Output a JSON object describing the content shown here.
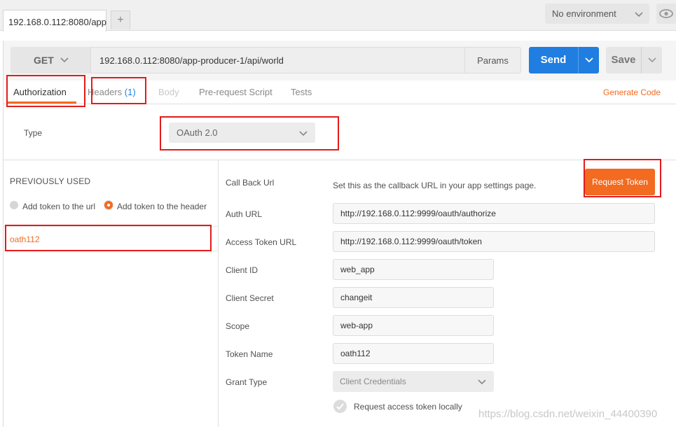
{
  "tab": {
    "title": "192.168.0.112:8080/app",
    "new_tab": "+"
  },
  "environment": {
    "selected": "No environment"
  },
  "request": {
    "method": "GET",
    "url": "192.168.0.112:8080/app-producer-1/api/world",
    "params_label": "Params",
    "send_label": "Send",
    "save_label": "Save"
  },
  "request_tabs": [
    {
      "label": "Authorization"
    },
    {
      "label": "Headers",
      "badge": "(1)"
    },
    {
      "label": "Body"
    },
    {
      "label": "Pre-request Script"
    },
    {
      "label": "Tests"
    }
  ],
  "generate_code": "Generate Code",
  "auth": {
    "type_label": "Type",
    "type_value": "OAuth 2.0",
    "previously_used": "PREVIOUSLY USED",
    "radio_url": "Add token to the url",
    "radio_header": "Add token to the header",
    "selected_radio": "header",
    "token_item": "oath112",
    "request_token_label": "Request Token",
    "callback_label": "Call Back Url",
    "callback_text": "Set this as the callback URL in your app settings page.",
    "fields": {
      "auth_url": {
        "label": "Auth URL",
        "value": "http://192.168.0.112:9999/oauth/authorize"
      },
      "access_token_url": {
        "label": "Access Token URL",
        "value": "http://192.168.0.112:9999/oauth/token"
      },
      "client_id": {
        "label": "Client ID",
        "value": "web_app"
      },
      "client_secret": {
        "label": "Client Secret",
        "value": "changeit"
      },
      "scope": {
        "label": "Scope",
        "value": "web-app"
      },
      "token_name": {
        "label": "Token Name",
        "value": "oath112"
      }
    },
    "grant_type_label": "Grant Type",
    "grant_type_value": "Client Credentials",
    "request_locally": "Request access token locally"
  },
  "watermark": "https://blog.csdn.net/weixin_44400390",
  "colors": {
    "accent": "#f26b21",
    "send": "#1f7ee0",
    "annotation": "#e41b1b"
  }
}
